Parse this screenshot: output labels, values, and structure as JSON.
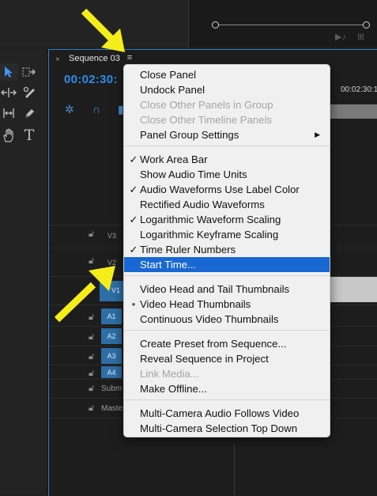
{
  "panel": {
    "tab_close": "×",
    "tab_title": "Sequence 03",
    "menu_icon": "≡",
    "timecode": "00:02:30:",
    "ruler_time": "00:02:30:1"
  },
  "tracks": {
    "video": [
      {
        "label": "V3"
      },
      {
        "label": "V2"
      },
      {
        "label": "V1"
      }
    ],
    "audio": [
      {
        "label": "A1"
      },
      {
        "label": "A2"
      },
      {
        "label": "A3"
      },
      {
        "label": "A4"
      }
    ],
    "submix": "Subm",
    "master": "Maste"
  },
  "menu": {
    "items": [
      {
        "label": "Close Panel",
        "checked": false,
        "disabled": false
      },
      {
        "label": "Undock Panel",
        "checked": false,
        "disabled": false
      },
      {
        "label": "Close Other Panels in Group",
        "checked": false,
        "disabled": true
      },
      {
        "label": "Close Other Timeline Panels",
        "checked": false,
        "disabled": true
      },
      {
        "label": "Panel Group Settings",
        "checked": false,
        "disabled": false,
        "submenu_arrow": "▶"
      },
      {
        "label": "Work Area Bar",
        "checked": true,
        "disabled": false
      },
      {
        "label": "Show Audio Time Units",
        "checked": false,
        "disabled": false
      },
      {
        "label": "Audio Waveforms Use Label Color",
        "checked": true,
        "disabled": false
      },
      {
        "label": "Rectified Audio Waveforms",
        "checked": false,
        "disabled": false
      },
      {
        "label": "Logarithmic Waveform Scaling",
        "checked": true,
        "disabled": false
      },
      {
        "label": "Logarithmic Keyframe Scaling",
        "checked": false,
        "disabled": false
      },
      {
        "label": "Time Ruler Numbers",
        "checked": true,
        "disabled": false
      },
      {
        "label": "Start Time...",
        "checked": false,
        "disabled": false,
        "selected": true
      },
      {
        "label": "Video Head and Tail Thumbnails",
        "checked": false,
        "disabled": false
      },
      {
        "label": "Video Head Thumbnails",
        "checked": false,
        "bullet": true,
        "disabled": false
      },
      {
        "label": "Continuous Video Thumbnails",
        "checked": false,
        "disabled": false
      },
      {
        "label": "Create Preset from Sequence...",
        "checked": false,
        "disabled": false
      },
      {
        "label": "Reveal Sequence in Project",
        "checked": false,
        "disabled": false
      },
      {
        "label": "Link Media...",
        "checked": false,
        "disabled": true
      },
      {
        "label": "Make Offline...",
        "checked": false,
        "disabled": false
      },
      {
        "label": "Multi-Camera Audio Follows Video",
        "checked": false,
        "disabled": false
      },
      {
        "label": "Multi-Camera Selection Top Down",
        "checked": false,
        "disabled": false
      }
    ],
    "check_glyph": "✓",
    "bullet_glyph": "•"
  },
  "icons": {
    "selection_tool": "selection-arrow-icon",
    "track_select_tool": "track-select-forward-icon",
    "ripple_tool": "ripple-edit-icon",
    "razor_tool": "razor-icon",
    "slip_tool": "slip-icon",
    "pen_tool": "pen-icon",
    "hand_tool": "hand-icon",
    "type_tool": "type-icon"
  },
  "colors": {
    "accent_blue": "#2d8ceb",
    "selection_blue": "#1967d2",
    "annotation_yellow": "#f5ed1a"
  }
}
